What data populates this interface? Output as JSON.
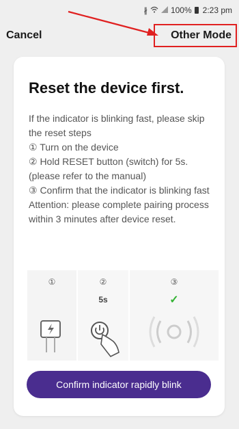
{
  "status_bar": {
    "icons": [
      "bluetooth-icon",
      "wifi-icon",
      "signal-icon",
      "battery-icon"
    ],
    "battery": "100%",
    "time": "2:23 pm"
  },
  "topbar": {
    "cancel_label": "Cancel",
    "other_mode_label": "Other Mode",
    "highlight_color": "#e02020"
  },
  "card": {
    "title": "Reset the device first.",
    "lines": [
      "If the indicator is blinking fast, please skip the reset steps",
      "① Turn on the device",
      "② Hold RESET button (switch) for 5s. (please refer to the manual)",
      "③ Confirm that the indicator is blinking fast",
      "Attention: please complete pairing process within 3 minutes after device reset."
    ],
    "steps": [
      {
        "number": "①",
        "icon": "power-plug-icon"
      },
      {
        "number": "②",
        "sub": "5s",
        "icon": "power-button-press-icon"
      },
      {
        "number": "③",
        "sub": "✓",
        "icon": "blinking-indicator-icon"
      }
    ],
    "confirm_label": "Confirm indicator rapidly blink",
    "accent_color": "#4a2d8f"
  }
}
